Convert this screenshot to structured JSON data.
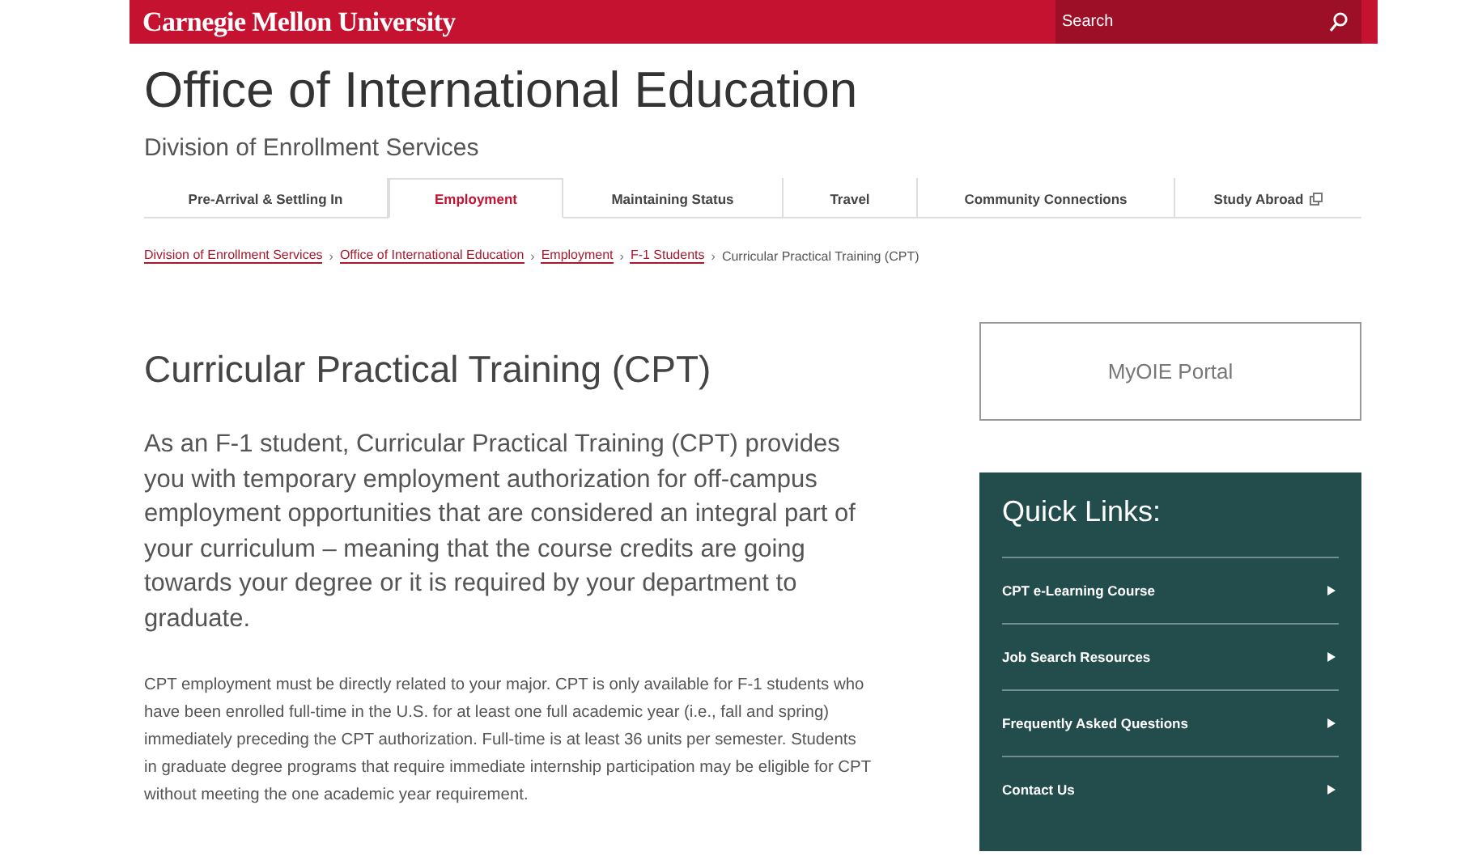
{
  "header": {
    "logo": "Carnegie Mellon University",
    "search": {
      "placeholder": "Search"
    }
  },
  "site": {
    "title": "Office of International Education",
    "subtitle": "Division of Enrollment Services"
  },
  "tabs": [
    {
      "label": "Pre-Arrival & Settling In",
      "selected": false,
      "external": false
    },
    {
      "label": "Employment",
      "selected": true,
      "external": false
    },
    {
      "label": "Maintaining Status",
      "selected": false,
      "external": false
    },
    {
      "label": "Travel",
      "selected": false,
      "external": false
    },
    {
      "label": "Community Connections",
      "selected": false,
      "external": false
    },
    {
      "label": "Study Abroad",
      "selected": false,
      "external": true
    }
  ],
  "breadcrumbs": [
    {
      "label": "Division of Enrollment Services",
      "link": true,
      "separator": "›"
    },
    {
      "label": "Office of International Education",
      "link": true,
      "separator": "›"
    },
    {
      "label": "Employment",
      "link": true,
      "separator": "›"
    },
    {
      "label": "F-1 Students",
      "link": true,
      "separator": "›"
    },
    {
      "label": "Curricular Practical Training (CPT)",
      "link": false
    }
  ],
  "page": {
    "title": "Curricular Practical Training (CPT)",
    "lead": "As an F-1 student, Curricular Practical Training (CPT) provides you with temporary employment authorization for off-campus employment opportunities that are considered an integral part of your curriculum – meaning that the course credits are going towards your degree or it is required by your department to graduate.",
    "body": "CPT employment must be directly related to your major. CPT is only available for F-1 students who have been enrolled full-time in the U.S. for at least one full academic year (i.e., fall and spring) immediately preceding the CPT authorization. Full-time is at least 36 units per semester. Students in graduate degree programs that require immediate internship participation may be eligible for CPT without meeting the one academic year requirement."
  },
  "sidebar": {
    "portal_button": "MyOIE Portal",
    "quick_links": {
      "title": "Quick Links:",
      "items": [
        "CPT e-Learning Course",
        "Job Search Resources",
        "Frequently Asked Questions",
        "Contact Us"
      ]
    }
  }
}
